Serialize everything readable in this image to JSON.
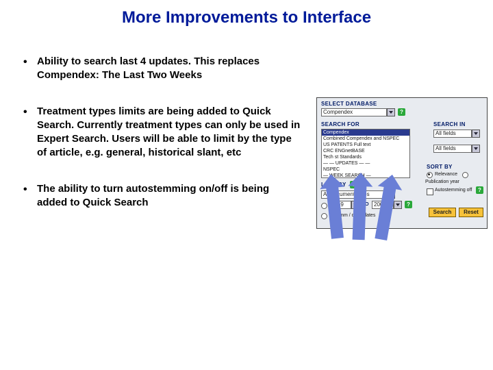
{
  "title": "More Improvements to Interface",
  "bullets": [
    "Ability to search last 4 updates.  This replaces Compendex: The Last Two Weeks",
    "Treatment types limits are being added to Quick Search.  Currently treatment types can only be used in Expert Search.  Users will be able to limit by the type of article, e.g. general, historical slant, etc",
    "The ability to turn autostemming on/off is being added to Quick Search"
  ],
  "panel": {
    "select_db_label": "SELECT DATABASE",
    "db_value": "Compendex",
    "search_for_label": "SEARCH FOR",
    "search_in_label": "SEARCH IN",
    "search_in_value1": "All fields",
    "search_in_value2": "All fields",
    "listbox": {
      "highlight": "Compendex",
      "items": [
        "Combined Compendex and NSPEC",
        "US PATENTS Full text",
        "CRC ENGnetBASE",
        "Tech st Standards",
        "— — UPDATES — —",
        "NSPEC",
        "— WEEK SEARCH —"
      ]
    },
    "limit_by_label": "LIMIT BY",
    "limit_value": "All document types",
    "year_from": "1969",
    "year_to_label": "TO",
    "year_to": "2005",
    "sort_by_label": "SORT BY",
    "sort_relevance": "Relevance",
    "sort_pubyear": "Publication year",
    "autostem": "Autostemming off",
    "btn_search": "Search",
    "btn_reset": "Reset",
    "last_updates": "Last mm / dd updates",
    "help_glyph": "?"
  }
}
